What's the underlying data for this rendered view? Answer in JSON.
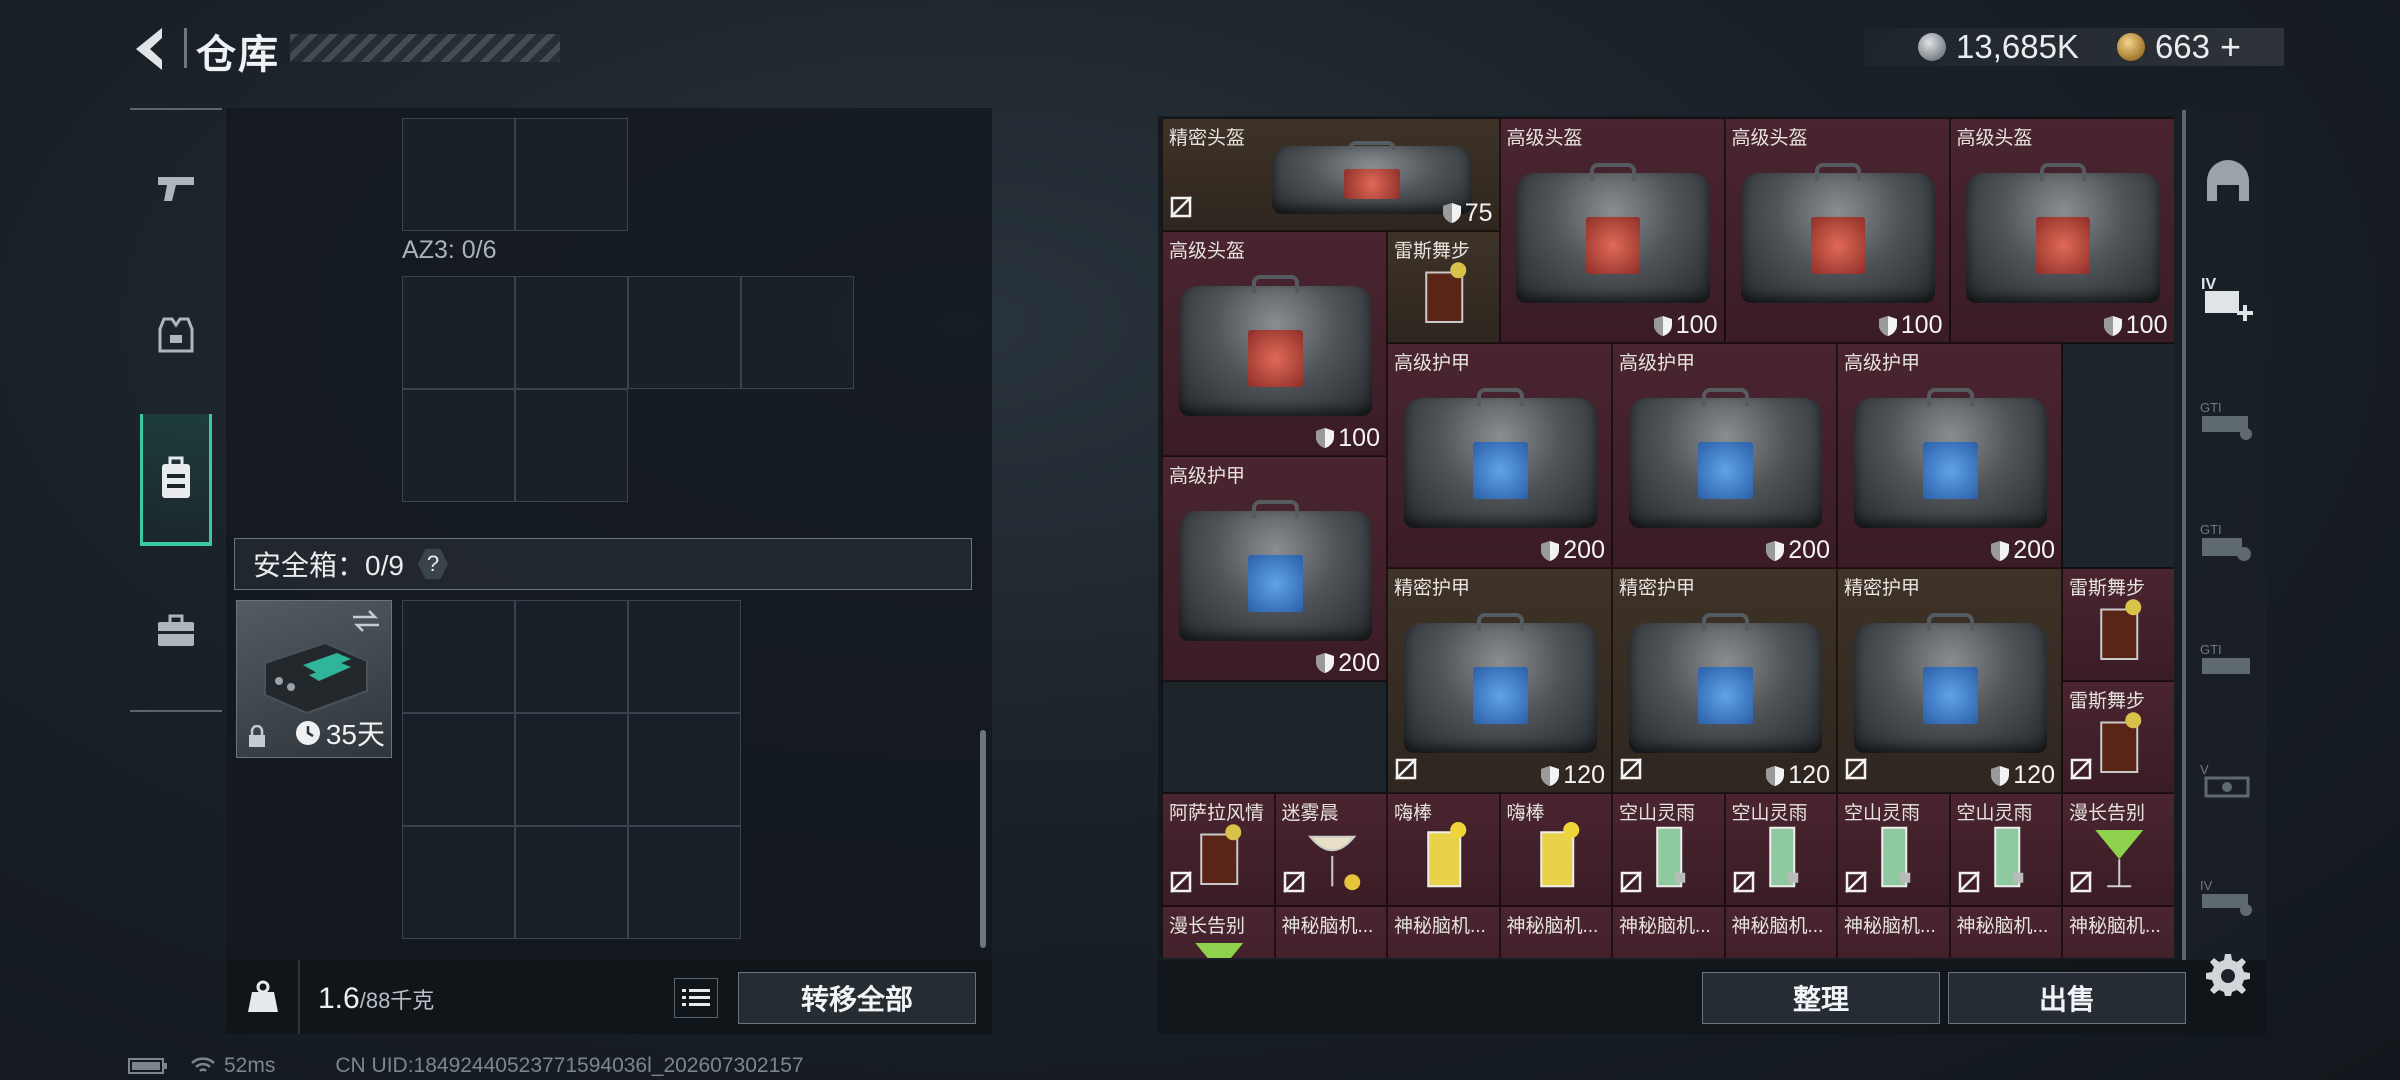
{
  "header": {
    "title": "仓库",
    "currency": [
      {
        "icon": "silver-coin-icon",
        "value": "13,685K"
      },
      {
        "icon": "gold-coin-icon",
        "value": "663"
      }
    ],
    "add_symbol": "+"
  },
  "left_panel": {
    "az3_label": "AZ3: 0/6",
    "safebox_label": "安全箱：0/9",
    "safebox_help": "?",
    "safebox_days": "35天",
    "weight_current": "1.6",
    "weight_max": "/88千克",
    "transfer_all": "转移全部"
  },
  "status": {
    "ping": "52ms",
    "uid": "CN UID:18492440523771594036l_202607302157"
  },
  "items": [
    {
      "name": "精密头盔",
      "dur": "75",
      "tier": "gold",
      "type": "bag-red",
      "lock": true
    },
    {
      "name": "高级头盔",
      "dur": "100",
      "tier": "purple",
      "type": "bag-red"
    },
    {
      "name": "高级头盔",
      "dur": "100",
      "tier": "purple",
      "type": "bag-red"
    },
    {
      "name": "高级头盔",
      "dur": "100",
      "tier": "purple",
      "type": "bag-red"
    },
    {
      "name": "高级头盔",
      "dur": "100",
      "tier": "purple",
      "type": "bag-red"
    },
    {
      "name": "雷斯舞步",
      "tier": "gold",
      "type": "drink-dark"
    },
    {
      "name": "高级护甲",
      "dur": "200",
      "tier": "purple",
      "type": "bag-blue"
    },
    {
      "name": "高级护甲",
      "dur": "200",
      "tier": "purple",
      "type": "bag-blue"
    },
    {
      "name": "高级护甲",
      "dur": "200",
      "tier": "purple",
      "type": "bag-blue"
    },
    {
      "name": "高级护甲",
      "dur": "200",
      "tier": "purple",
      "type": "bag-blue"
    },
    {
      "name": "精密护甲",
      "dur": "120",
      "tier": "gold",
      "type": "bag-blue",
      "lock": true
    },
    {
      "name": "精密护甲",
      "dur": "120",
      "tier": "gold",
      "type": "bag-blue",
      "lock": true
    },
    {
      "name": "精密护甲",
      "dur": "120",
      "tier": "gold",
      "type": "bag-blue",
      "lock": true
    },
    {
      "name": "雷斯舞步",
      "tier": "purple",
      "type": "drink-dark"
    },
    {
      "name": "雷斯舞步",
      "tier": "purple",
      "type": "drink-dark",
      "lock": true
    },
    {
      "name": "阿萨拉风情",
      "tier": "purple",
      "type": "drink-dark",
      "lock": true
    },
    {
      "name": "迷雾晨",
      "tier": "purple",
      "type": "drink-coupe",
      "lock": true
    },
    {
      "name": "嗨棒",
      "tier": "purple",
      "type": "drink-yellow"
    },
    {
      "name": "嗨棒",
      "tier": "purple",
      "type": "drink-yellow"
    },
    {
      "name": "空山灵雨",
      "tier": "purple",
      "type": "drink-green",
      "lock": true
    },
    {
      "name": "空山灵雨",
      "tier": "purple",
      "type": "drink-green",
      "lock": true
    },
    {
      "name": "空山灵雨",
      "tier": "purple",
      "type": "drink-green",
      "lock": true
    },
    {
      "name": "空山灵雨",
      "tier": "purple",
      "type": "drink-green",
      "lock": true
    },
    {
      "name": "漫长告别",
      "tier": "purple",
      "type": "drink-martini",
      "lock": true
    },
    {
      "name": "漫长告别",
      "tier": "purple",
      "type": "drink-martini"
    },
    {
      "name": "神秘脑机...",
      "tier": "purple",
      "type": "chip"
    },
    {
      "name": "神秘脑机...",
      "tier": "purple",
      "type": "chip"
    },
    {
      "name": "神秘脑机...",
      "tier": "purple",
      "type": "chip"
    },
    {
      "name": "神秘脑机...",
      "tier": "purple",
      "type": "chip"
    },
    {
      "name": "神秘脑机...",
      "tier": "purple",
      "type": "chip"
    },
    {
      "name": "神秘脑机...",
      "tier": "purple",
      "type": "chip"
    },
    {
      "name": "神秘脑机...",
      "tier": "purple",
      "type": "chip"
    },
    {
      "name": "神秘脑机...",
      "tier": "purple",
      "type": "chip"
    }
  ],
  "right_side": {
    "sort": "整理",
    "sell": "出售",
    "tab_labels": [
      "GTI",
      "GTI",
      "GTI",
      "V",
      "IV"
    ],
    "plus_badge": "IV"
  },
  "colors": {
    "accent": "#39c9a3",
    "tier_purple": "#4a2530",
    "tier_gold": "#3f3328"
  }
}
